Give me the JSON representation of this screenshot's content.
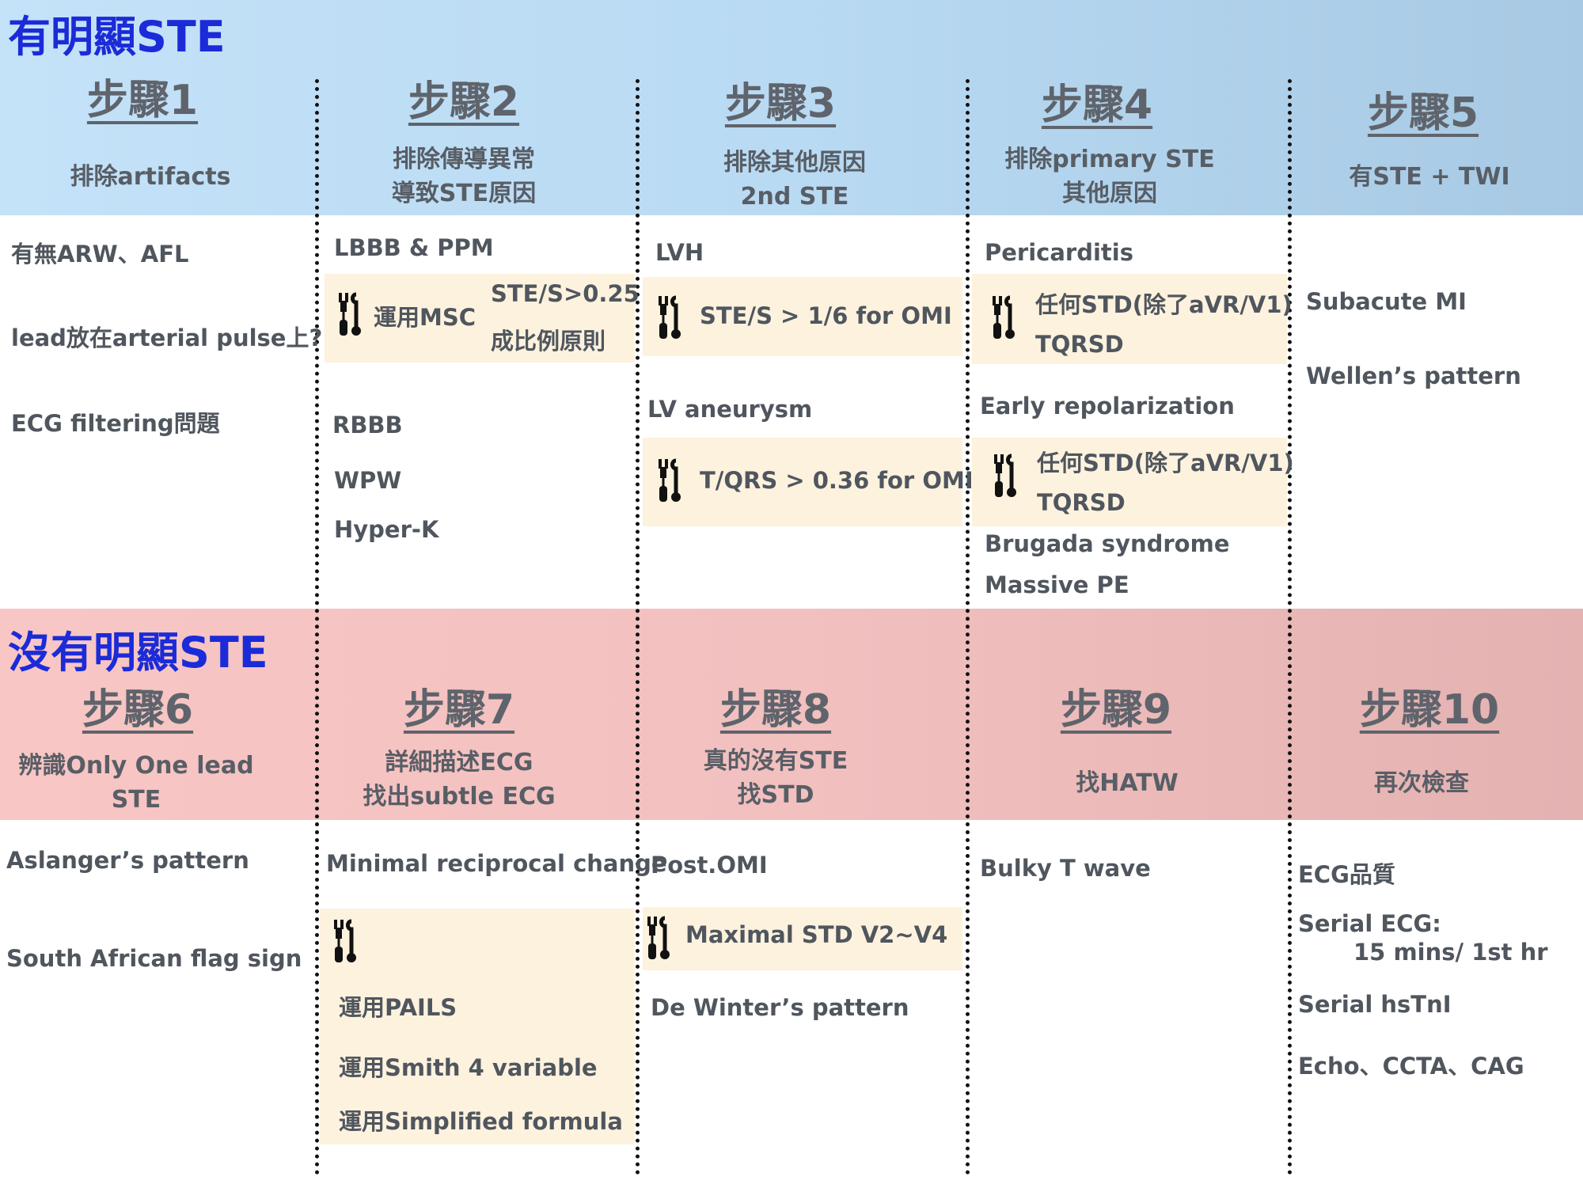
{
  "sections": {
    "top_title": "有明顯STE",
    "bottom_title": "沒有明顯STE"
  },
  "steps": [
    {
      "title": "步驟1",
      "sub1": "排除artifacts",
      "sub2": ""
    },
    {
      "title": "步驟2",
      "sub1": "排除傳導異常",
      "sub2": "導致STE原因"
    },
    {
      "title": "步驟3",
      "sub1": "排除其他原因",
      "sub2": "2nd STE"
    },
    {
      "title": "步驟4",
      "sub1": "排除primary STE",
      "sub2": "其他原因"
    },
    {
      "title": "步驟5",
      "sub1": "有STE + TWI",
      "sub2": ""
    },
    {
      "title": "步驟6",
      "sub1": "辨識Only One lead",
      "sub2": "STE"
    },
    {
      "title": "步驟7",
      "sub1": "詳細描述ECG",
      "sub2": "找出subtle ECG"
    },
    {
      "title": "步驟8",
      "sub1": "真的沒有STE",
      "sub2": "找STD"
    },
    {
      "title": "步驟9",
      "sub1": "找HATW",
      "sub2": ""
    },
    {
      "title": "步驟10",
      "sub1": "再次檢查",
      "sub2": ""
    }
  ],
  "col1": [
    "有無ARW、AFL",
    "lead放在arterial pulse上?",
    "ECG filtering問題"
  ],
  "col2": {
    "a": "LBBB & PPM",
    "tool_label": "運用MSC",
    "tool_r1": "STE/S>0.25",
    "tool_r2": "成比例原則",
    "b": "RBBB",
    "c": "WPW",
    "d": "Hyper-K"
  },
  "col3": {
    "a": "LVH",
    "tool1": "STE/S > 1/6 for OMI",
    "b": "LV aneurysm",
    "tool2": "T/QRS > 0.36 for OMI"
  },
  "col4": {
    "a": "Pericarditis",
    "tool1_l1": "任何STD(除了aVR/V1)",
    "tool1_l2": "TQRSD",
    "b": "Early repolarization",
    "tool2_l1": "任何STD(除了aVR/V1)",
    "tool2_l2": "TQRSD",
    "c": "Brugada syndrome",
    "d": "Massive PE"
  },
  "col5": [
    "Subacute MI",
    "Wellen’s pattern"
  ],
  "col6": [
    "Aslanger’s pattern",
    "South African flag sign"
  ],
  "col7": {
    "a": "Minimal reciprocal change",
    "t1": "運用PAILS",
    "t2": "運用Smith 4 variable",
    "t3": "運用Simplified formula"
  },
  "col8": {
    "a": "Post.OMI",
    "tool": "Maximal STD V2~V4",
    "b": "De Winter’s pattern"
  },
  "col9": [
    "Bulky T wave"
  ],
  "col10": {
    "a": "ECG品質",
    "b": "Serial ECG:",
    "b2": "15 mins/ 1st hr",
    "c": "Serial hsTnI",
    "d": "Echo、CCTA、CAG"
  },
  "icons": [
    "tools-icon"
  ],
  "colors": {
    "top_band": "#bddcf5",
    "bottom_band": "#f3c1c0",
    "box": "#fdf2de",
    "title_blue": "#1b2bd8"
  }
}
